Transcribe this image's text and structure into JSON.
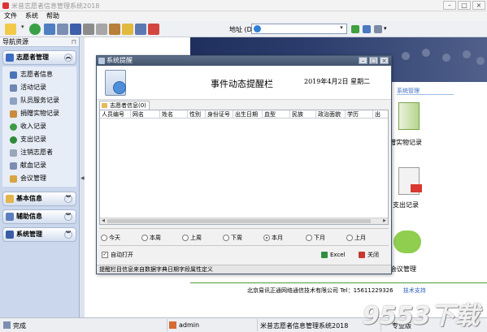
{
  "window": {
    "title": "米昔志愿者信息管理系统2018"
  },
  "menu": {
    "items": [
      "文件",
      "系统",
      "帮助"
    ]
  },
  "toolbar": {
    "icons": [
      "new-icon",
      "refresh-icon",
      "cube-icon",
      "save-icon",
      "view-icon",
      "print-icon",
      "printer-icon",
      "tools-icon",
      "lock-icon",
      "user-icon",
      "exit-icon"
    ],
    "address_label": "地址 (D):",
    "address_value": "",
    "go_icons": [
      "go-icon",
      "favorite-icon",
      "page-icon"
    ]
  },
  "left_panel": {
    "title": "导航资源",
    "groups": [
      {
        "label": "志愿者管理",
        "expanded": true,
        "items": [
          "志愿者信息",
          "活动记录",
          "队员服务记录",
          "捐赠实物记录",
          "收入记录",
          "支出记录",
          "注销志愿者",
          "献血记录",
          "会议管理"
        ]
      },
      {
        "label": "基本信息",
        "expanded": false
      },
      {
        "label": "辅助信息",
        "expanded": false
      },
      {
        "label": "系统管理",
        "expanded": false
      }
    ]
  },
  "main": {
    "section_title": "系统管理",
    "tiles": [
      {
        "label": "捐赠实物记录",
        "shown": "赠实物记录"
      },
      {
        "label": "支出记录",
        "shown": "支出记录"
      },
      {
        "label": "会议管理",
        "shown": "会议管理"
      }
    ],
    "footer": {
      "company": "北京易讯正通网络通信技术有限公司",
      "tel": "Tel：15611229326",
      "support": "技术支持"
    }
  },
  "dialog": {
    "title": "系统提醒",
    "heading": "事件动态提醒栏",
    "date": "2019年4月2日 星期二",
    "tab": "志愿者信息(0)",
    "columns": [
      "人员编号",
      "网名",
      "姓名",
      "性别",
      "身份证号",
      "出生日期",
      "血型",
      "民族",
      "政治面貌",
      "学历",
      "出"
    ],
    "ranges": [
      "今天",
      "本周",
      "上周",
      "下周",
      "本月",
      "下月",
      "上月"
    ],
    "selected_range": "本月",
    "auto_open_label": "自动打开",
    "auto_open_checked": true,
    "excel_label": "Excel",
    "close_label": "关闭",
    "status": "提醒栏目信息来自数据字典日期字段属性定义"
  },
  "statusbar": {
    "status": "完成",
    "user": "admin",
    "app": "米昔志愿者信息管理系统2018",
    "edition": "专业版"
  },
  "watermark": "9553下载"
}
